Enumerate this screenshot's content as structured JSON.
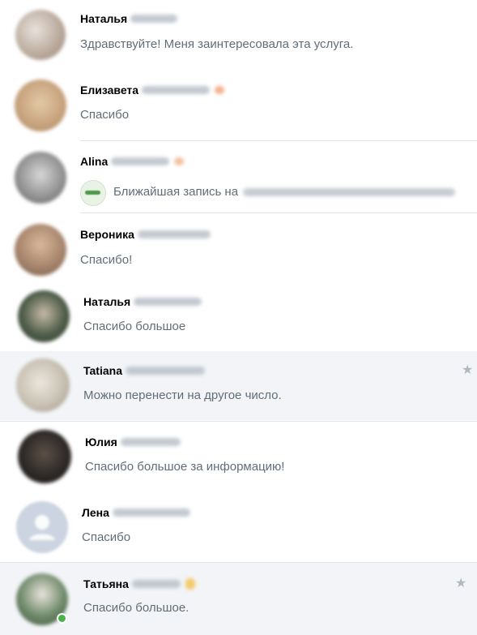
{
  "dialogs": [
    {
      "first_name": "Наталья",
      "message": "Здравствуйте! Меня заинтересовала эта услуга.",
      "avatar_color": "#b8a89a"
    },
    {
      "first_name": "Елизавета",
      "message": "Спасибо",
      "avatar_color": "#c9a57f"
    },
    {
      "first_name": "Alina",
      "attachment_text": "Ближайшая запись на",
      "avatar_color": "#8f8f8f"
    },
    {
      "first_name": "Вероника",
      "message": "Спасибо!",
      "avatar_color": "#a8866d"
    },
    {
      "first_name": "Наталья",
      "message": "Спасибо большое",
      "avatar_color": "#4f5e4a"
    },
    {
      "first_name": "Tatiana",
      "message": "Можно перенести на другое число.",
      "avatar_color": "#c8c1b3"
    },
    {
      "first_name": "Юлия",
      "message": "Спасибо большое за информацию!",
      "avatar_color": "#2e2a28"
    },
    {
      "first_name": "Лена",
      "message": "Спасибо",
      "avatar_color": "#cbd4e0"
    },
    {
      "first_name": "Татьяна",
      "message": "Спасибо большое.",
      "avatar_color": "#6f8a6a"
    }
  ],
  "colors": {
    "highlight_bg": "#f2f4f7",
    "message_text": "#626d7a",
    "name_text": "#000000",
    "divider": "#e1e5eb",
    "online": "#4bb34b",
    "star": "#b0b8c2"
  },
  "icons": {
    "star": "★",
    "attachment": "studio-logo-icon",
    "default_avatar": "user-silhouette-icon"
  }
}
